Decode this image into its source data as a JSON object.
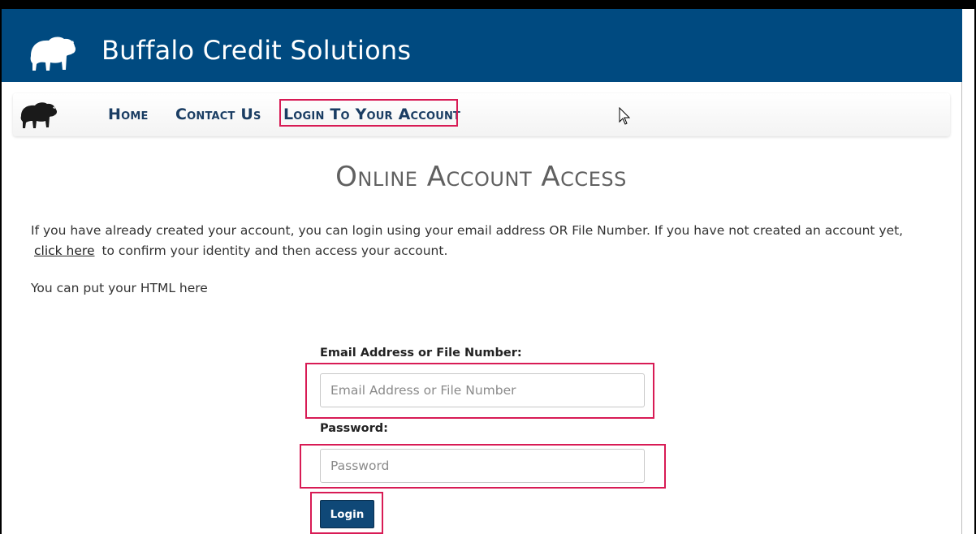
{
  "header": {
    "logo_icon": "buffalo-icon",
    "title": "Buffalo Credit Solutions",
    "background": "#004a80"
  },
  "nav": {
    "logo_icon": "buffalo-icon",
    "items": [
      {
        "label": "Home"
      },
      {
        "label": "Contact Us"
      },
      {
        "label": "Login To Your Account"
      }
    ]
  },
  "main": {
    "title": "Online Account Access",
    "intro_before": "If you have already created your account, you can login using your email address OR File Number. If you have not created an account yet,",
    "intro_link": "click here",
    "intro_after": "to confirm your identity and then access your account.",
    "html_note": "You can put your HTML here"
  },
  "form": {
    "email_label": "Email Address or File Number:",
    "email_placeholder": "Email Address or File Number",
    "password_label": "Password:",
    "password_placeholder": "Password",
    "login_label": "Login",
    "button_color": "#0f4877",
    "highlight_color": "#d81b55"
  }
}
